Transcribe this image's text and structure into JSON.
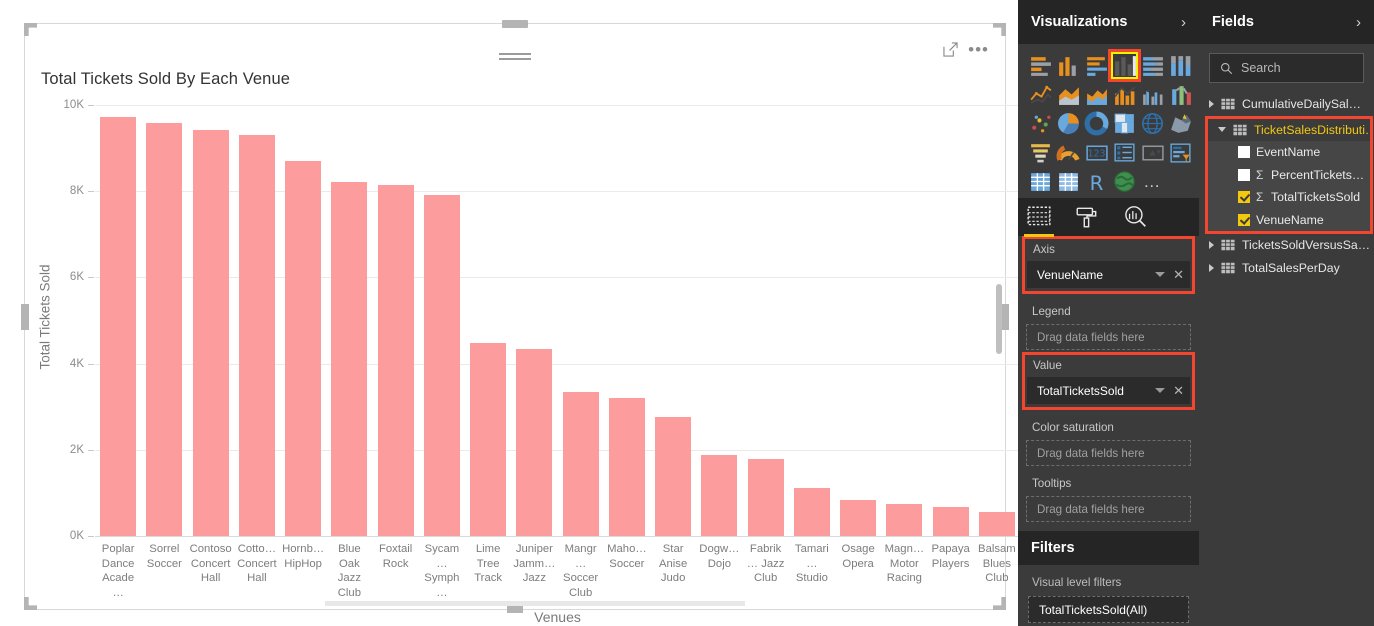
{
  "chart_data": {
    "type": "bar",
    "title": "Total Tickets Sold By Each Venue",
    "xlabel": "Venues",
    "ylabel": "Total Tickets Sold",
    "ylim": [
      0,
      10000
    ],
    "yticks": [
      "0K",
      "2K",
      "4K",
      "6K",
      "8K",
      "10K"
    ],
    "ytick_values": [
      0,
      2000,
      4000,
      6000,
      8000,
      10000
    ],
    "grid": true,
    "legend": "none",
    "bar_color": "#fc9c9c",
    "categories": [
      "Poplar Dance Acade…",
      "Sorrel Soccer",
      "Contoso Concert Hall",
      "Cotto… Concert Hall",
      "Hornb… HipHop",
      "Blue Oak Jazz Club",
      "Foxtail Rock",
      "Sycam… Symph…",
      "Lime Tree Track",
      "Juniper Jamm… Jazz",
      "Mangr… Soccer Club",
      "Maho… Soccer",
      "Star Anise Judo",
      "Dogw… Dojo",
      "Fabrik… Jazz Club",
      "Tamari… Studio",
      "Osage Opera",
      "Magn… Motor Racing",
      "Papaya Players",
      "Balsam Blues Club"
    ],
    "values": [
      9720,
      9580,
      9430,
      9300,
      8690,
      8220,
      8140,
      7910,
      4480,
      4340,
      3340,
      3210,
      2760,
      1880,
      1790,
      1110,
      830,
      740,
      680,
      560
    ]
  },
  "visual": {
    "expand_icon": "focus-mode-icon",
    "menu_icon": "more-options-icon"
  },
  "visualizations": {
    "title": "Visualizations",
    "expand_chevron": "chevron-right-icon",
    "icons": [
      "stacked-bar-chart-icon",
      "stacked-column-chart-icon",
      "clustered-bar-chart-icon",
      "clustered-column-chart-icon",
      "100-stacked-bar-chart-icon",
      "100-stacked-column-chart-icon",
      "line-chart-icon",
      "area-chart-icon",
      "stacked-area-chart-icon",
      "line-stacked-column-chart-icon",
      "line-clustered-column-chart-icon",
      "ribbon-chart-icon",
      "scatter-chart-icon",
      "pie-chart-icon",
      "donut-chart-icon",
      "treemap-icon",
      "map-icon",
      "filled-map-icon",
      "funnel-icon",
      "gauge-icon",
      "card-icon",
      "multi-row-card-icon",
      "kpi-icon",
      "slicer-icon",
      "table-icon",
      "matrix-icon",
      "r-script-visual-icon",
      "arcgis-maps-icon"
    ],
    "selected_icon_index": 3,
    "more_icon": "…",
    "tabs": [
      {
        "name": "fields-tab",
        "icon": "fields-table-icon",
        "active": true
      },
      {
        "name": "format-tab",
        "icon": "paint-roller-icon",
        "active": false
      },
      {
        "name": "analytics-tab",
        "icon": "analytics-magnifier-icon",
        "active": false
      }
    ],
    "wells": [
      {
        "label": "Axis",
        "value": "VenueName",
        "highlighted": true,
        "placeholder": null
      },
      {
        "label": "Legend",
        "value": null,
        "highlighted": false,
        "placeholder": "Drag data fields here"
      },
      {
        "label": "Value",
        "value": "TotalTicketsSold",
        "highlighted": true,
        "placeholder": null
      },
      {
        "label": "Color saturation",
        "value": null,
        "highlighted": false,
        "placeholder": "Drag data fields here"
      },
      {
        "label": "Tooltips",
        "value": null,
        "highlighted": false,
        "placeholder": "Drag data fields here"
      }
    ],
    "dropdown_icon": "chevron-down-icon",
    "remove_icon": "close-icon"
  },
  "filters": {
    "title": "Filters",
    "subtitle": "Visual level filters",
    "items": [
      "TotalTicketsSold(All)"
    ]
  },
  "fields": {
    "title": "Fields",
    "expand_chevron": "chevron-right-icon",
    "search_placeholder": "Search",
    "search_icon": "search-icon",
    "tables": [
      {
        "name": "CumulativeDailySal…",
        "expanded": false,
        "highlighted": false,
        "selected": false,
        "columns": []
      },
      {
        "name": "TicketSalesDistributi…",
        "expanded": true,
        "highlighted": true,
        "selected": true,
        "columns": [
          {
            "name": "EventName",
            "checked": false,
            "measure": false
          },
          {
            "name": "PercentTickets…",
            "checked": false,
            "measure": true
          },
          {
            "name": "TotalTicketsSold",
            "checked": true,
            "measure": true
          },
          {
            "name": "VenueName",
            "checked": true,
            "measure": false
          }
        ]
      },
      {
        "name": "TicketsSoldVersusSa…",
        "expanded": false,
        "highlighted": false,
        "selected": false,
        "columns": []
      },
      {
        "name": "TotalSalesPerDay",
        "expanded": false,
        "highlighted": false,
        "selected": false,
        "columns": []
      }
    ]
  },
  "colors": {
    "bar": "#fc9c9c",
    "highlight": "#f4462e",
    "accent_yellow": "#f2c811",
    "pane_bg": "#3b3b3b",
    "pane_header_bg": "#252525"
  }
}
